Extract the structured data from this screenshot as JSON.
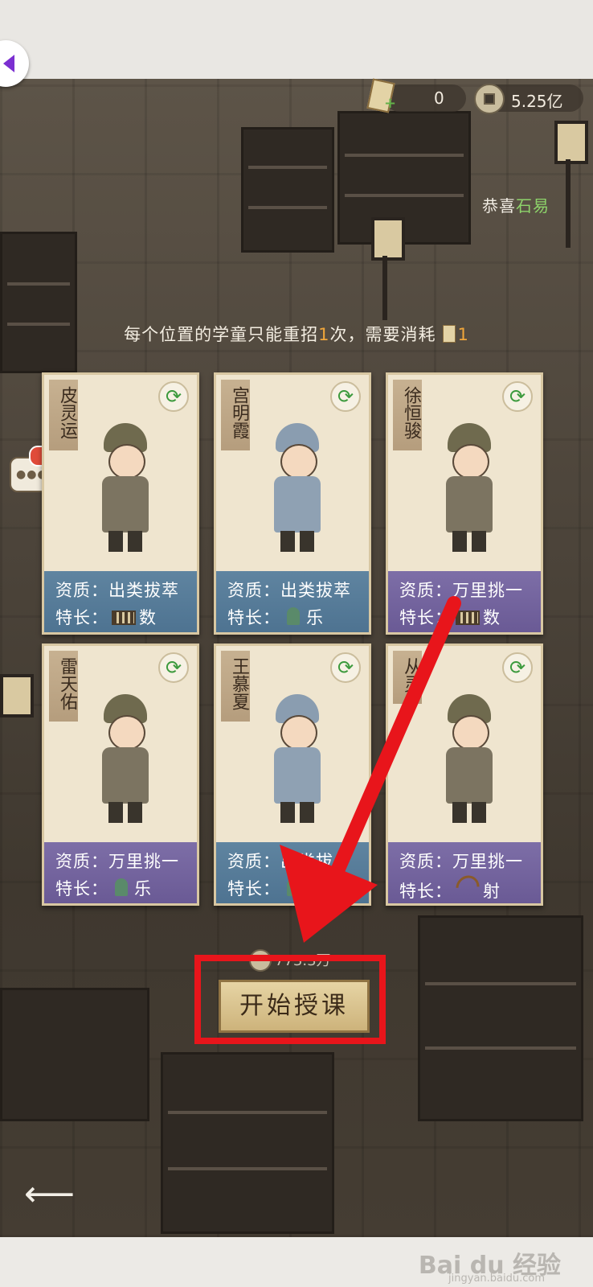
{
  "resources": {
    "tickets": "0",
    "coins": "5.25亿"
  },
  "congrats": {
    "prefix": "恭喜",
    "name": "石易"
  },
  "notice": {
    "text_before": "每个位置的学童只能重招",
    "count": "1",
    "text_mid": "次，需要消耗",
    "cost": "1"
  },
  "cards": [
    {
      "name": "皮灵运",
      "aptitude_label": "资质：",
      "aptitude": "出类拔萃",
      "specialty_label": "特长：",
      "specialty": "数",
      "specialty_icon": "abacus-icon",
      "tier_color": "#4e7391"
    },
    {
      "name": "宫明霞",
      "aptitude_label": "资质：",
      "aptitude": "出类拔萃",
      "specialty_label": "特长：",
      "specialty": "乐",
      "specialty_icon": "bell-icon",
      "tier_color": "#4e7391"
    },
    {
      "name": "徐恒骏",
      "aptitude_label": "资质：",
      "aptitude": "万里挑一",
      "specialty_label": "特长：",
      "specialty": "数",
      "specialty_icon": "abacus-icon",
      "tier_color": "#6a5a95"
    },
    {
      "name": "雷天佑",
      "aptitude_label": "资质：",
      "aptitude": "万里挑一",
      "specialty_label": "特长：",
      "specialty": "乐",
      "specialty_icon": "bell-icon",
      "tier_color": "#6a5a95"
    },
    {
      "name": "王慕夏",
      "aptitude_label": "资质：",
      "aptitude": "出类拔",
      "specialty_label": "特长：",
      "specialty": "",
      "specialty_icon": "bell-icon",
      "tier_color": "#4e7391"
    },
    {
      "name": "从灵",
      "aptitude_label": "资质：",
      "aptitude": "万里挑一",
      "specialty_label": "特长：",
      "specialty": "射",
      "specialty_icon": "bow-icon",
      "tier_color": "#6a5a95"
    }
  ],
  "start_button": {
    "label": "开始授课",
    "cost_text": "773.3万"
  },
  "watermark": {
    "brand": "Bai du 经验",
    "url": "jingyan.baidu.com"
  },
  "colors": {
    "highlight": "#e8151b",
    "accent_green": "#8dd36a",
    "accent_orange": "#f0a63b"
  }
}
